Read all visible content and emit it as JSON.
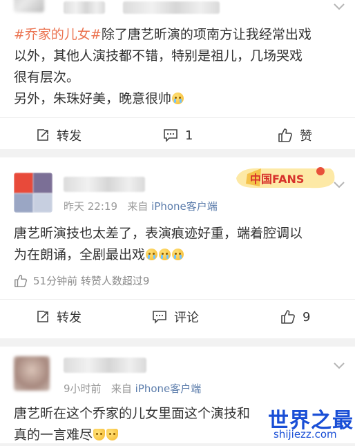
{
  "posts": [
    {
      "tag": "#乔家的儿女#",
      "text_lines": [
        "除了唐艺昕演的项南方让我经常出戏",
        "以外，其他人演技都不错，特别是祖儿，几场哭戏",
        "很有层次。"
      ],
      "text_line4": "另外，朱珠好美，晚意很帅",
      "actions": {
        "repost": "转发",
        "comment_count": "1",
        "like": "赞"
      }
    },
    {
      "meta_time": "昨天 22:19",
      "meta_from": "来自",
      "meta_source": "iPhone客户端",
      "badge_text": "中国FANS",
      "text_lines": [
        "唐艺昕演技也太差了，表演痕迹好重，端着腔调以",
        "为在朗诵，全剧最出戏"
      ],
      "like_info": "51分钟前 转赞人数超过9",
      "actions": {
        "repost": "转发",
        "comment": "评论",
        "like_count": "9"
      }
    },
    {
      "meta_time": "9小时前",
      "meta_from": "来自",
      "meta_source": "iPhone客户端",
      "text_lines": [
        "唐艺昕在这个乔家的儿女里面这个演技和",
        "真的一言难尽"
      ]
    }
  ],
  "watermark": {
    "title": "世界之最",
    "url": "shijiezz.com",
    "color": "#1a4fd6"
  },
  "colors": {
    "topic": "#eb7350",
    "link": "#5b7cab",
    "muted": "#9a9a9a"
  },
  "icons": [
    "repost-icon",
    "comment-icon",
    "like-icon",
    "chevron-down-icon"
  ]
}
